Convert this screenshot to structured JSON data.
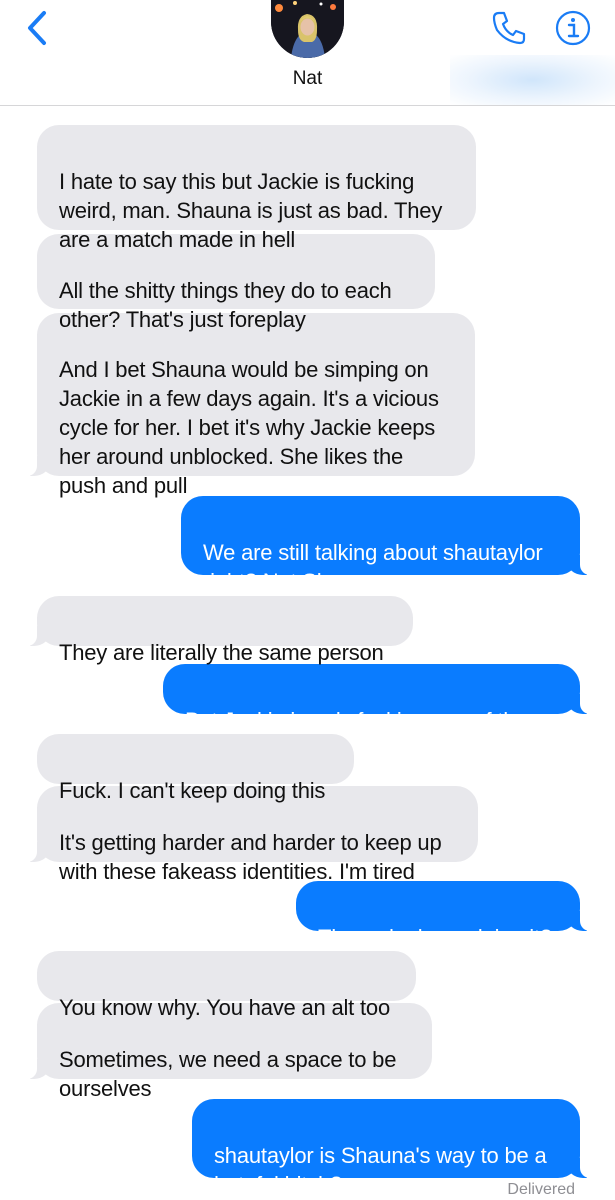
{
  "header": {
    "contact_name": "Nat"
  },
  "messages": [
    {
      "direction": "incoming",
      "text": "I hate to say this but Jackie is fucking\nweird, man. Shauna is just as bad. They\nare a match made in hell"
    },
    {
      "direction": "incoming",
      "text": "All the shitty things they do to each\nother? That's just foreplay"
    },
    {
      "direction": "incoming",
      "text": "And I bet Shauna would be simping on\nJackie in a few days again. It's a vicious\ncycle for her. I bet it's why Jackie keeps\nher around unblocked. She likes the\npush and pull"
    },
    {
      "direction": "outgoing",
      "text": "We are still talking about shautaylor\nright? Not Shauna"
    },
    {
      "direction": "incoming",
      "text": "They are literally the same person"
    },
    {
      "direction": "outgoing",
      "text": "But Jackie is only fucking one of them"
    },
    {
      "direction": "incoming",
      "text": "Fuck. I can't keep doing this"
    },
    {
      "direction": "incoming",
      "text": "It's getting harder and harder to keep up\nwith these fakeass identities. I'm tired"
    },
    {
      "direction": "outgoing",
      "text": "Then why keep doing it?"
    },
    {
      "direction": "incoming",
      "text": "You know why. You have an alt too"
    },
    {
      "direction": "incoming",
      "text": "Sometimes, we need a space to be\nourselves"
    },
    {
      "direction": "outgoing",
      "text": "shautaylor is Shauna's way to be a\nhateful bitch?"
    }
  ],
  "status": {
    "delivered_label": "Delivered"
  },
  "colors": {
    "accent": "#0a7cff",
    "incoming_bubble": "#e8e8ec",
    "header_icons": "#1a7cf5"
  },
  "icons": {
    "back": "chevron-left-icon",
    "phone": "phone-icon",
    "info": "info-icon"
  }
}
